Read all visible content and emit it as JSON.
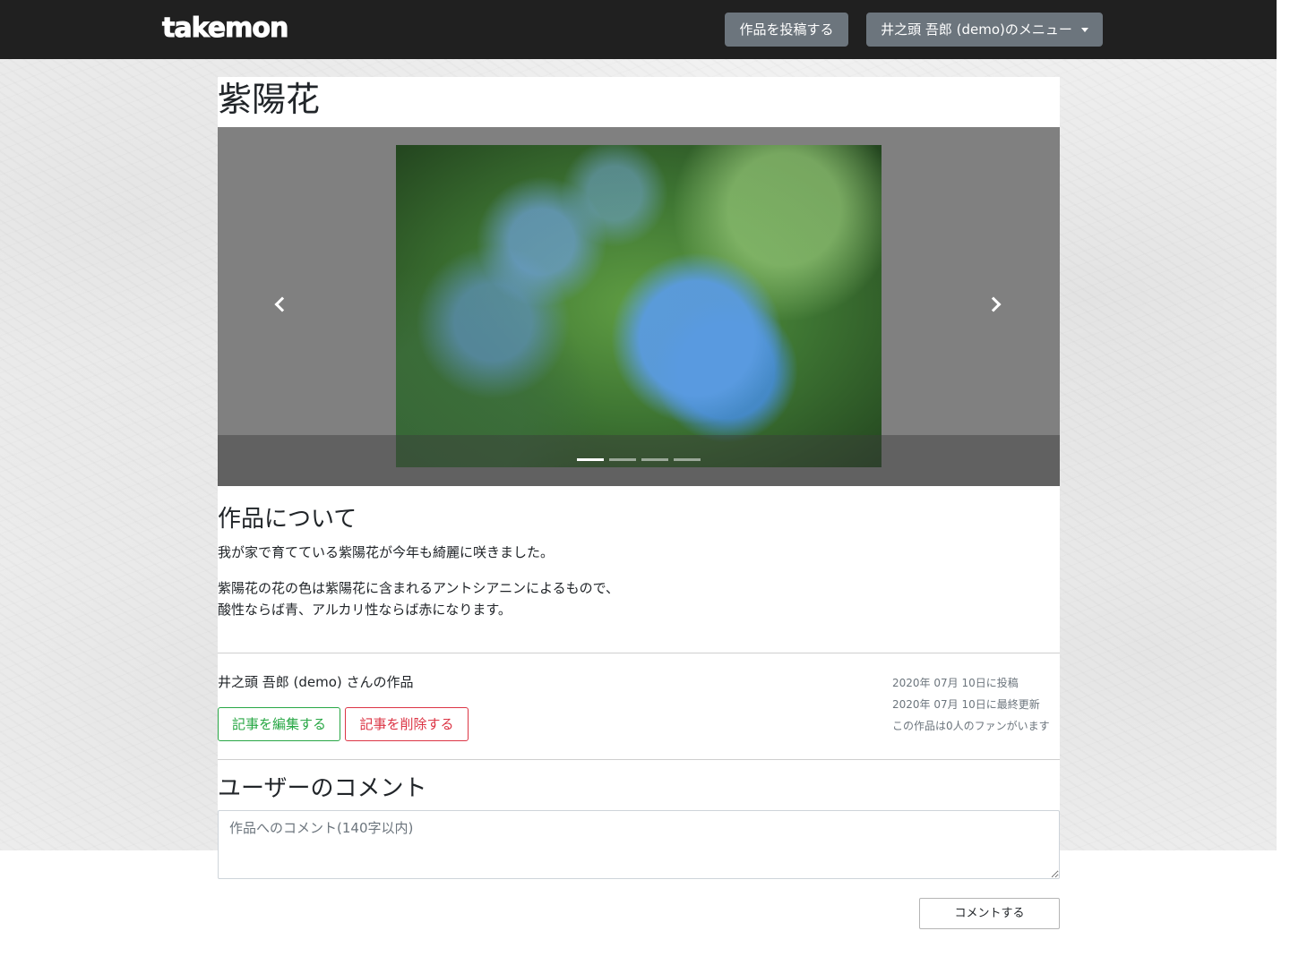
{
  "navbar": {
    "brand": "takemon",
    "post_button": "作品を投稿する",
    "user_menu": "井之頭 吾郎 (demo)のメニュー"
  },
  "work": {
    "title": "紫陽花",
    "carousel": {
      "slide_count": 4,
      "active_index": 0,
      "image_subject": "blue hydrangea photo"
    },
    "about_heading": "作品について",
    "description_line1": "我が家で育てている紫陽花が今年も綺麗に咲きました。",
    "description_line2": "紫陽花の花の色は紫陽花に含まれるアントシアニンによるもので、",
    "description_line3": "酸性ならば青、アルカリ性ならば赤になります。",
    "author_line": "井之頭 吾郎 (demo) さんの作品",
    "posted": "2020年 07月 10日に投稿",
    "updated": "2020年 07月 10日に最終更新",
    "fans": "この作品は0人のファンがいます",
    "edit_button": "記事を編集する",
    "delete_button": "記事を削除する"
  },
  "comments": {
    "heading": "ユーザーのコメント",
    "placeholder": "作品へのコメント(140字以内)",
    "submit_button": "コメントする"
  },
  "colors": {
    "navbar_bg": "#202020",
    "nav_button_bg": "#6c757d",
    "edit_green": "#28a745",
    "delete_red": "#dc3545"
  }
}
